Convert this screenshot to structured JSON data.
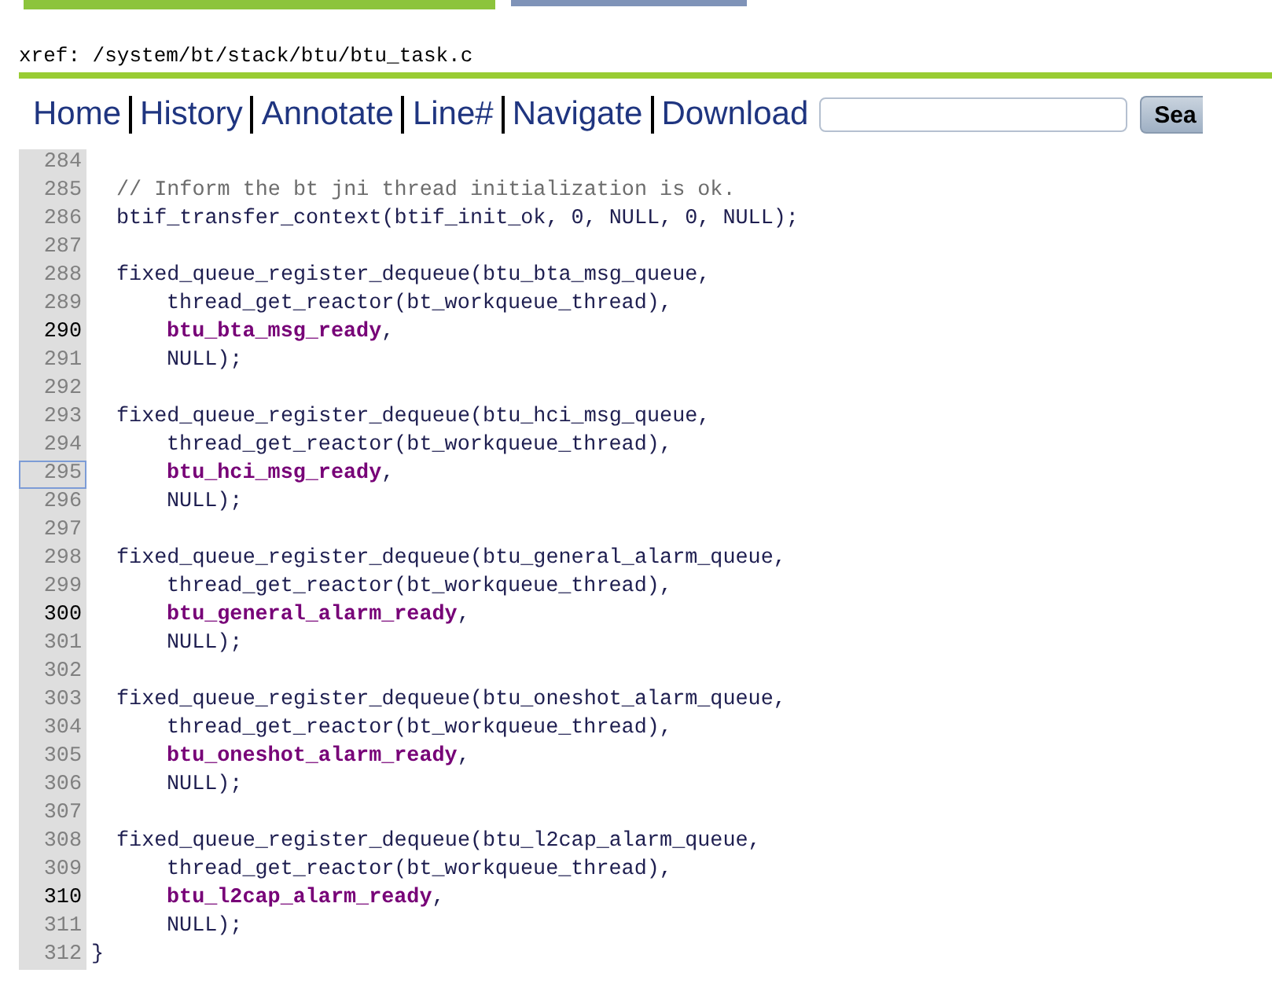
{
  "breadcrumb": "xref: /system/bt/stack/btu/btu_task.c",
  "nav": [
    {
      "label": "Home"
    },
    {
      "label": "History"
    },
    {
      "label": "Annotate"
    },
    {
      "label": "Line#"
    },
    {
      "label": "Navigate"
    },
    {
      "label": "Download"
    }
  ],
  "search": {
    "button": "Sea"
  },
  "code": [
    {
      "number": "284",
      "emphasized": false,
      "selected": false
    },
    {
      "number": "285",
      "emphasized": false,
      "selected": false,
      "kind": "body",
      "segments": [
        {
          "kind": "comment",
          "text": "// Inform the bt jni thread initialization is ok."
        }
      ]
    },
    {
      "number": "286",
      "emphasized": false,
      "selected": false,
      "kind": "body",
      "segments": [
        {
          "kind": "plain",
          "text": "btif_transfer_context(btif_init_ok, 0, NULL, 0, NULL);"
        }
      ]
    },
    {
      "number": "287",
      "emphasized": false,
      "selected": false
    },
    {
      "number": "288",
      "emphasized": false,
      "selected": false,
      "kind": "body",
      "segments": [
        {
          "kind": "plain",
          "text": "fixed_queue_register_dequeue(btu_bta_msg_queue,"
        }
      ]
    },
    {
      "number": "289",
      "emphasized": false,
      "selected": false,
      "kind": "continuation",
      "segments": [
        {
          "kind": "plain",
          "text": "thread_get_reactor(bt_workqueue_thread),"
        }
      ]
    },
    {
      "number": "290",
      "emphasized": true,
      "selected": false,
      "kind": "continuation",
      "segments": [
        {
          "kind": "reference",
          "text": "btu_bta_msg_ready"
        },
        {
          "kind": "plain",
          "text": ","
        }
      ]
    },
    {
      "number": "291",
      "emphasized": false,
      "selected": false,
      "kind": "continuation",
      "segments": [
        {
          "kind": "plain",
          "text": "NULL);"
        }
      ]
    },
    {
      "number": "292",
      "emphasized": false,
      "selected": false
    },
    {
      "number": "293",
      "emphasized": false,
      "selected": false,
      "kind": "body",
      "segments": [
        {
          "kind": "plain",
          "text": "fixed_queue_register_dequeue(btu_hci_msg_queue,"
        }
      ]
    },
    {
      "number": "294",
      "emphasized": false,
      "selected": false,
      "kind": "continuation",
      "segments": [
        {
          "kind": "plain",
          "text": "thread_get_reactor(bt_workqueue_thread),"
        }
      ]
    },
    {
      "number": "295",
      "emphasized": false,
      "selected": true,
      "kind": "continuation",
      "segments": [
        {
          "kind": "reference",
          "text": "btu_hci_msg_ready"
        },
        {
          "kind": "plain",
          "text": ","
        }
      ]
    },
    {
      "number": "296",
      "emphasized": false,
      "selected": false,
      "kind": "continuation",
      "segments": [
        {
          "kind": "plain",
          "text": "NULL);"
        }
      ]
    },
    {
      "number": "297",
      "emphasized": false,
      "selected": false
    },
    {
      "number": "298",
      "emphasized": false,
      "selected": false,
      "kind": "body",
      "segments": [
        {
          "kind": "plain",
          "text": "fixed_queue_register_dequeue(btu_general_alarm_queue,"
        }
      ]
    },
    {
      "number": "299",
      "emphasized": false,
      "selected": false,
      "kind": "continuation",
      "segments": [
        {
          "kind": "plain",
          "text": "thread_get_reactor(bt_workqueue_thread),"
        }
      ]
    },
    {
      "number": "300",
      "emphasized": true,
      "selected": false,
      "kind": "continuation",
      "segments": [
        {
          "kind": "reference",
          "text": "btu_general_alarm_ready"
        },
        {
          "kind": "plain",
          "text": ","
        }
      ]
    },
    {
      "number": "301",
      "emphasized": false,
      "selected": false,
      "kind": "continuation",
      "segments": [
        {
          "kind": "plain",
          "text": "NULL);"
        }
      ]
    },
    {
      "number": "302",
      "emphasized": false,
      "selected": false
    },
    {
      "number": "303",
      "emphasized": false,
      "selected": false,
      "kind": "body",
      "segments": [
        {
          "kind": "plain",
          "text": "fixed_queue_register_dequeue(btu_oneshot_alarm_queue,"
        }
      ]
    },
    {
      "number": "304",
      "emphasized": false,
      "selected": false,
      "kind": "continuation",
      "segments": [
        {
          "kind": "plain",
          "text": "thread_get_reactor(bt_workqueue_thread),"
        }
      ]
    },
    {
      "number": "305",
      "emphasized": false,
      "selected": false,
      "kind": "continuation",
      "segments": [
        {
          "kind": "reference",
          "text": "btu_oneshot_alarm_ready"
        },
        {
          "kind": "plain",
          "text": ","
        }
      ]
    },
    {
      "number": "306",
      "emphasized": false,
      "selected": false,
      "kind": "continuation",
      "segments": [
        {
          "kind": "plain",
          "text": "NULL);"
        }
      ]
    },
    {
      "number": "307",
      "emphasized": false,
      "selected": false
    },
    {
      "number": "308",
      "emphasized": false,
      "selected": false,
      "kind": "body",
      "segments": [
        {
          "kind": "plain",
          "text": "fixed_queue_register_dequeue(btu_l2cap_alarm_queue,"
        }
      ]
    },
    {
      "number": "309",
      "emphasized": false,
      "selected": false,
      "kind": "continuation",
      "segments": [
        {
          "kind": "plain",
          "text": "thread_get_reactor(bt_workqueue_thread),"
        }
      ]
    },
    {
      "number": "310",
      "emphasized": true,
      "selected": false,
      "kind": "continuation",
      "segments": [
        {
          "kind": "reference",
          "text": "btu_l2cap_alarm_ready"
        },
        {
          "kind": "plain",
          "text": ","
        }
      ]
    },
    {
      "number": "311",
      "emphasized": false,
      "selected": false,
      "kind": "continuation",
      "segments": [
        {
          "kind": "plain",
          "text": "NULL);"
        }
      ]
    },
    {
      "number": "312",
      "emphasized": false,
      "selected": false,
      "kind": "top",
      "segments": [
        {
          "kind": "plain",
          "text": "}"
        }
      ]
    }
  ]
}
